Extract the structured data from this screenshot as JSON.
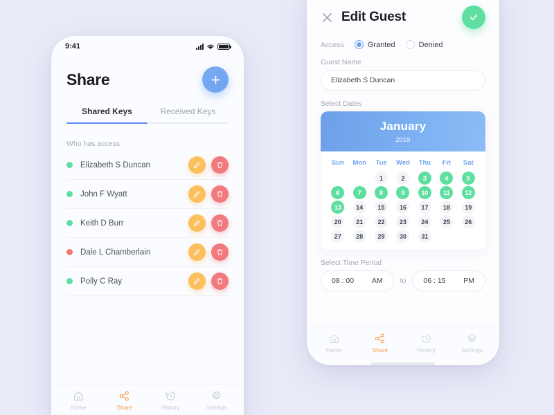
{
  "colors": {
    "background": "#eaebf8",
    "accent_blue": "#6ea3ef",
    "accent_green": "#5edfa0",
    "accent_orange": "#fbbf5c",
    "accent_red": "#f17a7e",
    "nav_active": "#f5a04a"
  },
  "left_phone": {
    "status_bar": {
      "time": "9:41"
    },
    "title": "Share",
    "add_button_label": "+",
    "tabs": [
      {
        "label": "Shared Keys",
        "active": true
      },
      {
        "label": "Received Keys",
        "active": false
      }
    ],
    "section_label": "Who has access",
    "people": [
      {
        "name": "Elizabeth S Duncan",
        "access": "granted"
      },
      {
        "name": "John F Wyatt",
        "access": "granted"
      },
      {
        "name": "Keith D Burr",
        "access": "granted"
      },
      {
        "name": "Dale L Chamberlain",
        "access": "denied"
      },
      {
        "name": "Polly C Ray",
        "access": "granted"
      }
    ],
    "nav": [
      {
        "label": "Home",
        "icon": "home-icon",
        "active": false
      },
      {
        "label": "Share",
        "icon": "share-icon",
        "active": true
      },
      {
        "label": "History",
        "icon": "history-icon",
        "active": false
      },
      {
        "label": "Settings",
        "icon": "settings-icon",
        "active": false
      }
    ]
  },
  "right_phone": {
    "title": "Edit Guest",
    "close_icon": "close-icon",
    "confirm_icon": "check-icon",
    "access": {
      "label": "Access",
      "options": [
        {
          "label": "Granted",
          "selected": true
        },
        {
          "label": "Denied",
          "selected": false
        }
      ]
    },
    "guest_name": {
      "label": "Guest Name",
      "value": "Elizabeth S Duncan",
      "placeholder": "Guest Name"
    },
    "dates": {
      "label": "Select Dates",
      "month": "January",
      "year": "2019",
      "weekdays": [
        "Sun",
        "Mon",
        "Tue",
        "Wed",
        "Thu",
        "Fri",
        "Sat"
      ],
      "leading_blanks": 2,
      "days": [
        1,
        2,
        3,
        4,
        5,
        6,
        7,
        8,
        9,
        10,
        11,
        12,
        13,
        14,
        15,
        16,
        17,
        18,
        19,
        20,
        21,
        22,
        23,
        24,
        25,
        26,
        27,
        28,
        29,
        30,
        31
      ],
      "selected_days": [
        3,
        4,
        5,
        6,
        7,
        8,
        9,
        10,
        11,
        12,
        13
      ]
    },
    "time_period": {
      "label": "Select Time Period",
      "start_time": "08 : 00",
      "start_meridiem": "AM",
      "separator": "to",
      "end_time": "06 : 15",
      "end_meridiem": "PM"
    },
    "nav": [
      {
        "label": "Home",
        "icon": "home-icon",
        "active": false
      },
      {
        "label": "Share",
        "icon": "share-icon",
        "active": true
      },
      {
        "label": "History",
        "icon": "history-icon",
        "active": false
      },
      {
        "label": "Settings",
        "icon": "settings-icon",
        "active": false
      }
    ]
  }
}
